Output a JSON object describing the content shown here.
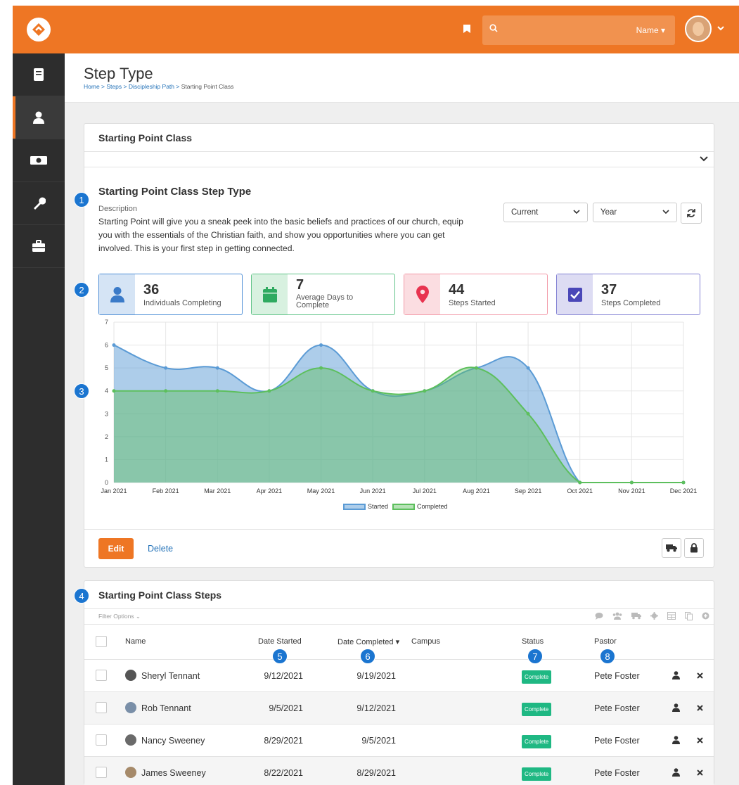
{
  "topbar": {
    "search_dropdown": "Name"
  },
  "page": {
    "title": "Step Type",
    "breadcrumb": [
      "Home",
      "Steps",
      "Discipleship Path",
      "Starting Point Class"
    ]
  },
  "panel": {
    "header": "Starting Point Class",
    "step_title": "Starting Point Class Step Type",
    "description_label": "Description",
    "description": "Starting Point will give you a sneak peek into the basic beliefs and practices of our church, equip you with the essentials of the Christian faith, and show you opportunities where you can get involved. This is your first step in getting connected.",
    "filter_period": "Current",
    "filter_unit": "Year",
    "edit_label": "Edit",
    "delete_label": "Delete"
  },
  "kpis": [
    {
      "value": "36",
      "label": "Individuals Completing",
      "icon": "person-icon",
      "color": "#3a7ac8",
      "bg": "#d5e4f5",
      "border": "#4f8fd6"
    },
    {
      "value": "7",
      "label_line1": "Average Days to",
      "label_line2": "Complete",
      "icon": "calendar-icon",
      "color": "#2faa60",
      "bg": "#d8f1e0",
      "border": "#62c489"
    },
    {
      "value": "44",
      "label": "Steps Started",
      "icon": "map-pin-icon",
      "color": "#e8334f",
      "bg": "#fbdde1",
      "border": "#f29aa8"
    },
    {
      "value": "37",
      "label": "Steps Completed",
      "icon": "checkbox-icon",
      "color": "#4a47b8",
      "bg": "#dddcf3",
      "border": "#8483d4"
    }
  ],
  "chart_data": {
    "type": "area",
    "x": [
      "Jan 2021",
      "Feb 2021",
      "Mar 2021",
      "Apr 2021",
      "May 2021",
      "Jun 2021",
      "Jul 2021",
      "Aug 2021",
      "Sep 2021",
      "Oct 2021",
      "Nov 2021",
      "Dec 2021"
    ],
    "series": [
      {
        "name": "Started",
        "values": [
          6,
          5,
          5,
          4,
          6,
          4,
          4,
          5,
          5,
          0,
          0,
          0
        ],
        "color": "#5b9bd5"
      },
      {
        "name": "Completed",
        "values": [
          4,
          4,
          4,
          4,
          5,
          4,
          4,
          5,
          3,
          0,
          0,
          0
        ],
        "color": "#5dbf5d"
      }
    ],
    "ylim": [
      0,
      7
    ],
    "yticks": [
      "0",
      "1",
      "2",
      "3",
      "4",
      "5",
      "6",
      "7"
    ],
    "grid": true,
    "legend": "bottom-center"
  },
  "grid": {
    "title": "Starting Point Class Steps",
    "filter_label": "Filter Options",
    "columns": {
      "name": "Name",
      "date_started": "Date Started",
      "date_completed": "Date Completed",
      "campus": "Campus",
      "status": "Status",
      "pastor": "Pastor"
    },
    "rows": [
      {
        "name": "Sheryl Tennant",
        "date_started": "9/12/2021",
        "date_completed": "9/19/2021",
        "status": "Complete",
        "pastor": "Pete Foster"
      },
      {
        "name": "Rob Tennant",
        "date_started": "9/5/2021",
        "date_completed": "9/12/2021",
        "status": "Complete",
        "pastor": "Pete Foster"
      },
      {
        "name": "Nancy Sweeney",
        "date_started": "8/29/2021",
        "date_completed": "9/5/2021",
        "status": "Complete",
        "pastor": "Pete Foster"
      },
      {
        "name": "James Sweeney",
        "date_started": "8/22/2021",
        "date_completed": "8/29/2021",
        "status": "Complete",
        "pastor": "Pete Foster"
      }
    ]
  },
  "callouts": [
    "1",
    "2",
    "3",
    "4",
    "5",
    "6",
    "7",
    "8"
  ]
}
